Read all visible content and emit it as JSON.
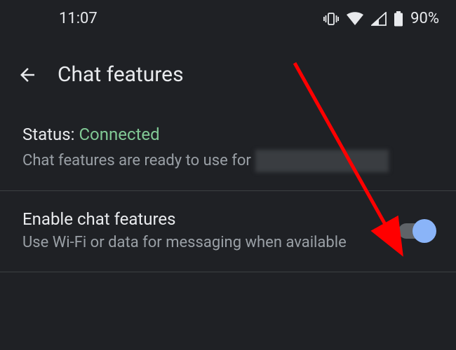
{
  "status_bar": {
    "time": "11:07",
    "battery_pct": "90%"
  },
  "header": {
    "title": "Chat features"
  },
  "status_section": {
    "label": "Status:",
    "value": "Connected",
    "description": "Chat features are ready to use for"
  },
  "enable_setting": {
    "title": "Enable chat features",
    "description": "Use Wi-Fi or data for messaging when available",
    "enabled": true
  },
  "colors": {
    "bg": "#1f2125",
    "text_primary": "#e8eaed",
    "text_secondary": "#9aa0a6",
    "accent_green": "#81c995",
    "accent_blue": "#8ab4f8",
    "divider": "#3c4043",
    "arrow": "#ff0000"
  }
}
